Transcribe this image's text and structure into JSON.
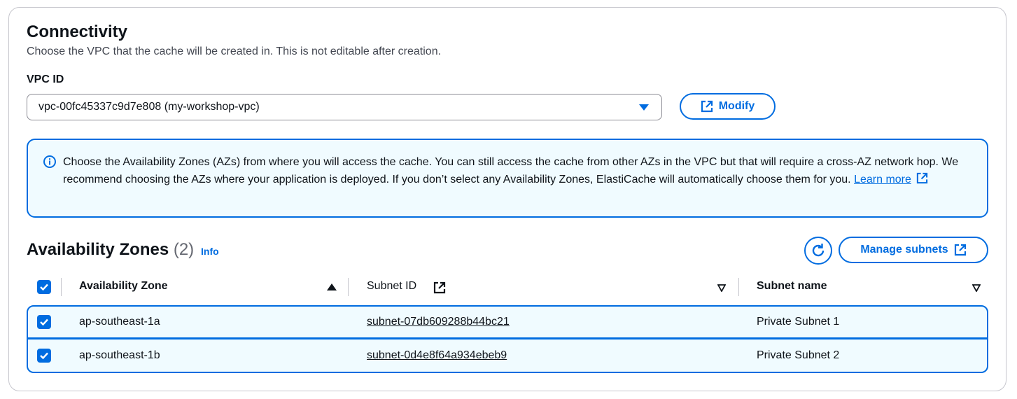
{
  "connectivity": {
    "title": "Connectivity",
    "description": "Choose the VPC that the cache will be created in. This is not editable after creation.",
    "vpc_label": "VPC ID",
    "vpc_selected": "vpc-00fc45337c9d7e808 (my-workshop-vpc)",
    "modify_label": "Modify"
  },
  "alert": {
    "text": "Choose the Availability Zones (AZs) from where you will access the cache. You can still access the cache from other AZs in the VPC but that will require a cross-AZ network hop. We recommend choosing the AZs where your application is deployed. If you don’t select any Availability Zones, ElastiCache will automatically choose them for you.",
    "learn_more": "Learn more"
  },
  "az": {
    "title": "Availability Zones",
    "count": "(2)",
    "info": "Info",
    "manage_subnets": "Manage subnets",
    "columns": [
      "Availability Zone",
      "Subnet ID",
      "Subnet name"
    ],
    "rows": [
      {
        "zone": "ap-southeast-1a",
        "subnet_id": "subnet-07db609288b44bc21",
        "subnet_name": "Private Subnet 1",
        "checked": true
      },
      {
        "zone": "ap-southeast-1b",
        "subnet_id": "subnet-0d4e8f64a934ebeb9",
        "subnet_name": "Private Subnet 2",
        "checked": true
      }
    ]
  },
  "colors": {
    "accent": "#006ce0",
    "alert_bg": "#f0fbff",
    "text": "#0f141a"
  },
  "icons": [
    "external-link-icon",
    "info-icon",
    "refresh-icon",
    "caret-down-icon",
    "checkbox-checked-icon",
    "sort-ascending-icon",
    "sort-icon"
  ]
}
